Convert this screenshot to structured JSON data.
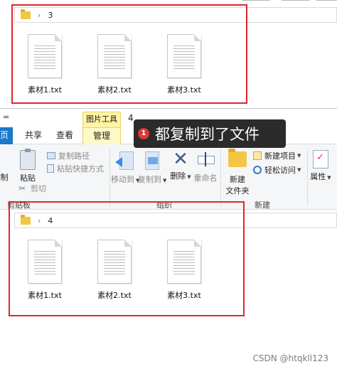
{
  "top_window": {
    "folder_path": "3",
    "path_separator": "›",
    "files": [
      "素材1.txt",
      "素材2.txt",
      "素材3.txt"
    ]
  },
  "bottom_window": {
    "quick_access_mark": "=",
    "context_tab_title": "图片工具",
    "window_title": "4",
    "tabs": {
      "file": "页",
      "share": "共享",
      "view": "查看",
      "manage": "管理"
    },
    "ribbon": {
      "clipboard": {
        "pin_fragment": "制",
        "paste": "粘贴",
        "copy_path": "复制路径",
        "paste_shortcut": "粘贴快捷方式",
        "cut": "剪切",
        "group_label": "剪贴板"
      },
      "organize": {
        "move_to": "移动到",
        "copy_to": "复制到",
        "delete": "删除",
        "rename": "重命名",
        "group_label": "组织"
      },
      "new": {
        "new_item": "新建项目",
        "easy_access": "轻松访问",
        "new_folder_line1": "新建",
        "new_folder_line2": "文件夹",
        "group_label": "新建"
      },
      "open": {
        "properties": "属性"
      }
    },
    "folder_path": "4",
    "path_separator": "›",
    "files": [
      "素材1.txt",
      "素材2.txt",
      "素材3.txt"
    ]
  },
  "annotation": {
    "badge": "1",
    "text": "都复制到了文件"
  },
  "watermark": "CSDN @htqkll123",
  "colors": {
    "highlight_frame": "#e0262d",
    "annotation_bg": "#2b2b2b",
    "badge": "#e2363a",
    "context_tab": "#fff4a6",
    "file_tab": "#1979ca",
    "folder": "#f3c646"
  }
}
